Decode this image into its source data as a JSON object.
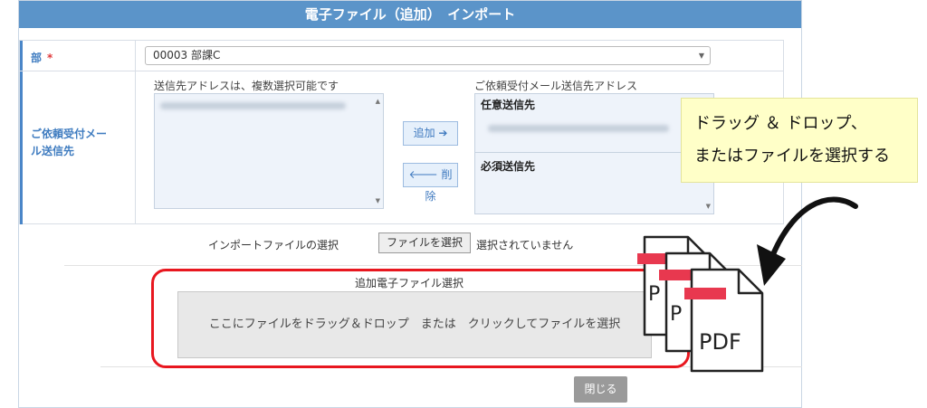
{
  "dialog": {
    "title": "電子ファイル（追加）　インポート"
  },
  "form": {
    "department": {
      "label": "部",
      "required_mark": "*",
      "value": "00003 部課C"
    },
    "mail": {
      "label_line1": "ご依頼受付メー",
      "label_line2": "ル送信先",
      "left_caption": "送信先アドレスは、複数選択可能です",
      "right_caption": "ご依頼受付メール送信先アドレス",
      "add_label": "追加 ➔",
      "remove_label": "🡐 削除",
      "optional_label": "任意送信先",
      "required_label": "必須送信先"
    }
  },
  "import": {
    "label": "インポートファイルの選択",
    "button": "ファイルを選択",
    "status": "選択されていません"
  },
  "dropzone": {
    "title": "追加電子ファイル選択",
    "text": "ここにファイルをドラッグ＆ドロップ　または　クリックしてファイルを選択"
  },
  "footer": {
    "close": "閉じる"
  },
  "callout": {
    "line1": "ドラッグ ＆ ドロップ、",
    "line2": "またはファイルを選択する"
  },
  "pdf_icon": {
    "text": "PDF",
    "accent": "#e8384f"
  },
  "colors": {
    "title_bar": "#5b94c9",
    "label_text": "#3f7cc0",
    "highlight_red": "#e8171f",
    "callout_bg": "#ffffc8"
  }
}
